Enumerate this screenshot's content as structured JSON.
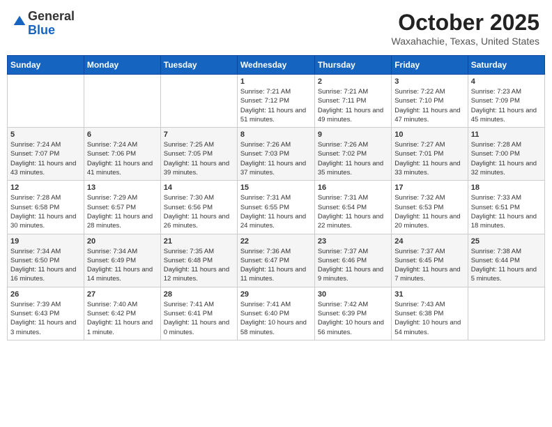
{
  "header": {
    "logo_general": "General",
    "logo_blue": "Blue",
    "month": "October 2025",
    "location": "Waxahachie, Texas, United States"
  },
  "weekdays": [
    "Sunday",
    "Monday",
    "Tuesday",
    "Wednesday",
    "Thursday",
    "Friday",
    "Saturday"
  ],
  "weeks": [
    [
      {
        "day": "",
        "info": ""
      },
      {
        "day": "",
        "info": ""
      },
      {
        "day": "",
        "info": ""
      },
      {
        "day": "1",
        "info": "Sunrise: 7:21 AM\nSunset: 7:12 PM\nDaylight: 11 hours and 51 minutes."
      },
      {
        "day": "2",
        "info": "Sunrise: 7:21 AM\nSunset: 7:11 PM\nDaylight: 11 hours and 49 minutes."
      },
      {
        "day": "3",
        "info": "Sunrise: 7:22 AM\nSunset: 7:10 PM\nDaylight: 11 hours and 47 minutes."
      },
      {
        "day": "4",
        "info": "Sunrise: 7:23 AM\nSunset: 7:09 PM\nDaylight: 11 hours and 45 minutes."
      }
    ],
    [
      {
        "day": "5",
        "info": "Sunrise: 7:24 AM\nSunset: 7:07 PM\nDaylight: 11 hours and 43 minutes."
      },
      {
        "day": "6",
        "info": "Sunrise: 7:24 AM\nSunset: 7:06 PM\nDaylight: 11 hours and 41 minutes."
      },
      {
        "day": "7",
        "info": "Sunrise: 7:25 AM\nSunset: 7:05 PM\nDaylight: 11 hours and 39 minutes."
      },
      {
        "day": "8",
        "info": "Sunrise: 7:26 AM\nSunset: 7:03 PM\nDaylight: 11 hours and 37 minutes."
      },
      {
        "day": "9",
        "info": "Sunrise: 7:26 AM\nSunset: 7:02 PM\nDaylight: 11 hours and 35 minutes."
      },
      {
        "day": "10",
        "info": "Sunrise: 7:27 AM\nSunset: 7:01 PM\nDaylight: 11 hours and 33 minutes."
      },
      {
        "day": "11",
        "info": "Sunrise: 7:28 AM\nSunset: 7:00 PM\nDaylight: 11 hours and 32 minutes."
      }
    ],
    [
      {
        "day": "12",
        "info": "Sunrise: 7:28 AM\nSunset: 6:58 PM\nDaylight: 11 hours and 30 minutes."
      },
      {
        "day": "13",
        "info": "Sunrise: 7:29 AM\nSunset: 6:57 PM\nDaylight: 11 hours and 28 minutes."
      },
      {
        "day": "14",
        "info": "Sunrise: 7:30 AM\nSunset: 6:56 PM\nDaylight: 11 hours and 26 minutes."
      },
      {
        "day": "15",
        "info": "Sunrise: 7:31 AM\nSunset: 6:55 PM\nDaylight: 11 hours and 24 minutes."
      },
      {
        "day": "16",
        "info": "Sunrise: 7:31 AM\nSunset: 6:54 PM\nDaylight: 11 hours and 22 minutes."
      },
      {
        "day": "17",
        "info": "Sunrise: 7:32 AM\nSunset: 6:53 PM\nDaylight: 11 hours and 20 minutes."
      },
      {
        "day": "18",
        "info": "Sunrise: 7:33 AM\nSunset: 6:51 PM\nDaylight: 11 hours and 18 minutes."
      }
    ],
    [
      {
        "day": "19",
        "info": "Sunrise: 7:34 AM\nSunset: 6:50 PM\nDaylight: 11 hours and 16 minutes."
      },
      {
        "day": "20",
        "info": "Sunrise: 7:34 AM\nSunset: 6:49 PM\nDaylight: 11 hours and 14 minutes."
      },
      {
        "day": "21",
        "info": "Sunrise: 7:35 AM\nSunset: 6:48 PM\nDaylight: 11 hours and 12 minutes."
      },
      {
        "day": "22",
        "info": "Sunrise: 7:36 AM\nSunset: 6:47 PM\nDaylight: 11 hours and 11 minutes."
      },
      {
        "day": "23",
        "info": "Sunrise: 7:37 AM\nSunset: 6:46 PM\nDaylight: 11 hours and 9 minutes."
      },
      {
        "day": "24",
        "info": "Sunrise: 7:37 AM\nSunset: 6:45 PM\nDaylight: 11 hours and 7 minutes."
      },
      {
        "day": "25",
        "info": "Sunrise: 7:38 AM\nSunset: 6:44 PM\nDaylight: 11 hours and 5 minutes."
      }
    ],
    [
      {
        "day": "26",
        "info": "Sunrise: 7:39 AM\nSunset: 6:43 PM\nDaylight: 11 hours and 3 minutes."
      },
      {
        "day": "27",
        "info": "Sunrise: 7:40 AM\nSunset: 6:42 PM\nDaylight: 11 hours and 1 minute."
      },
      {
        "day": "28",
        "info": "Sunrise: 7:41 AM\nSunset: 6:41 PM\nDaylight: 11 hours and 0 minutes."
      },
      {
        "day": "29",
        "info": "Sunrise: 7:41 AM\nSunset: 6:40 PM\nDaylight: 10 hours and 58 minutes."
      },
      {
        "day": "30",
        "info": "Sunrise: 7:42 AM\nSunset: 6:39 PM\nDaylight: 10 hours and 56 minutes."
      },
      {
        "day": "31",
        "info": "Sunrise: 7:43 AM\nSunset: 6:38 PM\nDaylight: 10 hours and 54 minutes."
      },
      {
        "day": "",
        "info": ""
      }
    ]
  ]
}
